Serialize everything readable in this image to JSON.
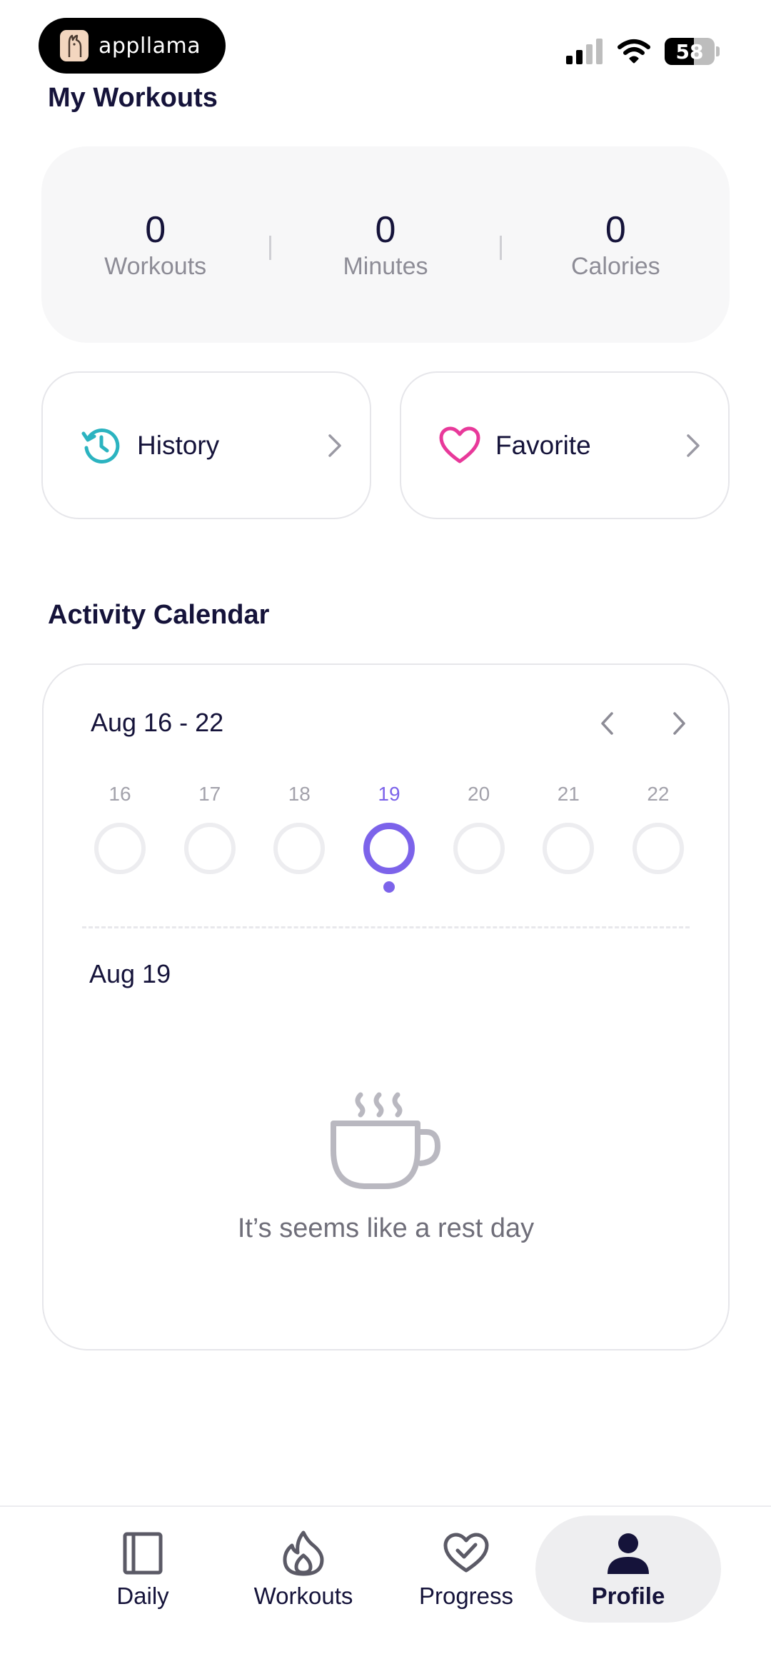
{
  "status_bar": {
    "app_name": "appllama",
    "battery": "58",
    "battery_level": 0.58
  },
  "my_workouts": {
    "title": "My Workouts",
    "stats": [
      {
        "value": "0",
        "label": "Workouts"
      },
      {
        "value": "0",
        "label": "Minutes"
      },
      {
        "value": "0",
        "label": "Calories"
      }
    ]
  },
  "shortcuts": {
    "history_label": "History",
    "favorite_label": "Favorite",
    "history_icon": "history-clock-icon",
    "favorite_icon": "heart-icon",
    "history_color": "#2bb3c0",
    "favorite_color": "#e8399a"
  },
  "activity_calendar": {
    "title": "Activity Calendar",
    "range": "Aug 16 - 22",
    "days": [
      "16",
      "17",
      "18",
      "19",
      "20",
      "21",
      "22"
    ],
    "selected_day": "19",
    "selected_date": "Aug 19",
    "empty_message": "It’s seems like a rest day",
    "accent": "#7c63ea"
  },
  "tabs": [
    {
      "label": "Daily",
      "icon": "book-icon"
    },
    {
      "label": "Workouts",
      "icon": "flame-icon"
    },
    {
      "label": "Progress",
      "icon": "heart-check-icon"
    },
    {
      "label": "Profile",
      "icon": "person-icon",
      "active": true
    }
  ]
}
